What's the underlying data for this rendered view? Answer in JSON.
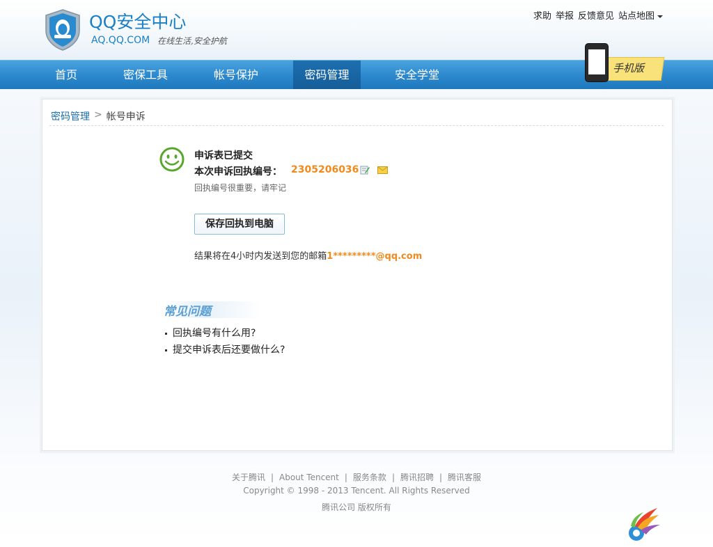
{
  "brand": {
    "title": "QQ安全中心",
    "domain": "AQ.QQ.COM",
    "slogan": "在线生活,安全护航"
  },
  "top_links": [
    "求助",
    "举报",
    "反馈意见",
    "站点地图"
  ],
  "nav": {
    "items": [
      {
        "label": "首页",
        "active": false
      },
      {
        "label": "密保工具",
        "active": false
      },
      {
        "label": "帐号保护",
        "active": false
      },
      {
        "label": "密码管理",
        "active": true
      },
      {
        "label": "安全学堂",
        "active": false
      }
    ],
    "mobile_badge": "手机版"
  },
  "breadcrumb": {
    "parent": "密码管理",
    "separator": ">",
    "current": "帐号申诉"
  },
  "result": {
    "title": "申诉表已提交",
    "receipt_label": "本次申诉回执编号：",
    "receipt_number": "2305206036",
    "hint": "回执编号很重要，请牢记",
    "save_button": "保存回执到电脑",
    "email_prefix": "结果将在4小时内发送到您的邮箱",
    "email": "1*********@qq.com"
  },
  "faq": {
    "title": "常见问题",
    "items": [
      "回执编号有什么用?",
      "提交申诉表后还要做什么?"
    ]
  },
  "footer": {
    "links": [
      "关于腾讯",
      "About Tencent",
      "服务条款",
      "腾讯招聘",
      "腾讯客服"
    ],
    "separator": "|",
    "copyright": "Copyright © 1998 - 2013 Tencent. All Rights Reserved",
    "company": "腾讯公司 版权所有"
  },
  "colors": {
    "brand_blue": "#1b7fc6",
    "nav_blue": "#2c88cc",
    "nav_active": "#155d98",
    "accent_orange": "#f08a1c",
    "smiley_green": "#58a62c"
  }
}
